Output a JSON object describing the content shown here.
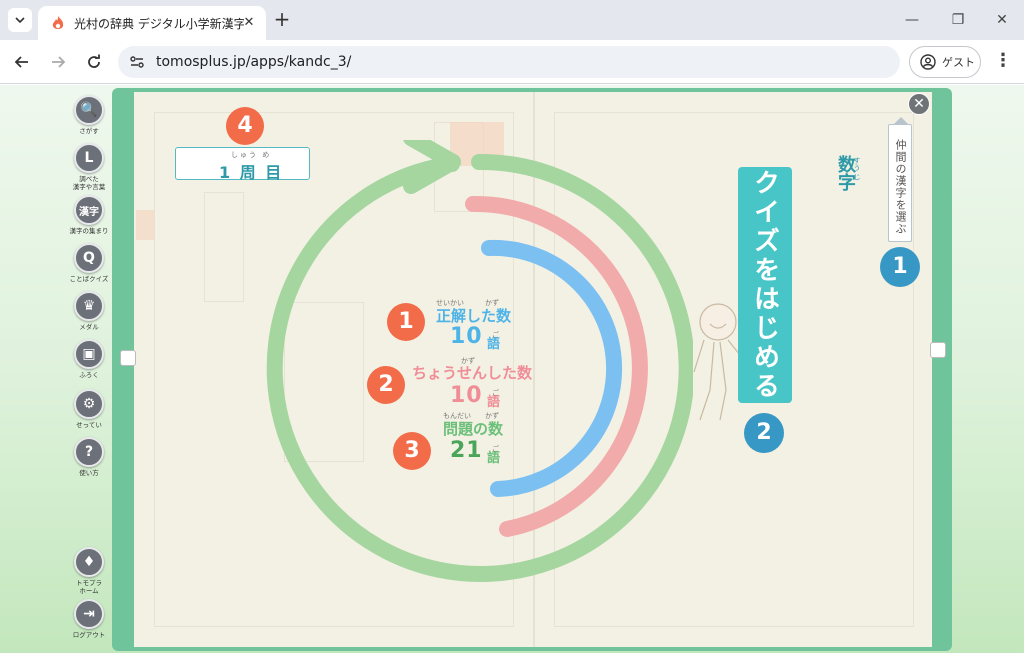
{
  "browser": {
    "tab_title": "光村の辞典 デジタル小学新漢字辞典",
    "url": "tomosplus.jp/apps/kandc_3/",
    "profile_label": "ゲスト"
  },
  "sidebar": {
    "items": [
      {
        "label": "さがす",
        "icon": "search-icon",
        "glyph": "🔍"
      },
      {
        "label": "調べた\n漢字や言葉",
        "icon": "history-icon",
        "glyph": "L"
      },
      {
        "label": "漢字の集まり",
        "icon": "kanji-icon",
        "glyph": "漢字"
      },
      {
        "label": "ことばクイズ",
        "icon": "quiz-icon",
        "glyph": "Q"
      },
      {
        "label": "メダル",
        "icon": "medal-icon",
        "glyph": "♛"
      },
      {
        "label": "ふろく",
        "icon": "gift-icon",
        "glyph": "▣"
      },
      {
        "label": "せってい",
        "icon": "settings-icon",
        "glyph": "⚙"
      },
      {
        "label": "使い方",
        "icon": "help-icon",
        "glyph": "?"
      },
      {
        "label": "トモプラ\nホーム",
        "icon": "home-icon",
        "glyph": "♦"
      },
      {
        "label": "ログアウト",
        "icon": "logout-icon",
        "glyph": "⇥"
      }
    ]
  },
  "quiz": {
    "round_ruby": "しゅう め",
    "round_label": "1 周 目",
    "round_badge": "4",
    "start_label": "クイズをはじめる",
    "start_badge": "2",
    "category_label": "数字",
    "category_ruby": "すう じ",
    "group_select_label": "仲間の漢字を選ぶ",
    "group_badge": "1",
    "close_icon": "close-icon",
    "stats": [
      {
        "badge": "1",
        "ruby": "せいかい　　　かず",
        "label": "正解した数",
        "value": "10",
        "unit_ruby": "ご",
        "unit": "語",
        "color": "#4eb4e8"
      },
      {
        "badge": "2",
        "ruby": "　　　　　　　かず",
        "label": "ちょうせんした数",
        "value": "10",
        "unit_ruby": "ご",
        "unit": "語",
        "color": "#f08e98"
      },
      {
        "badge": "3",
        "ruby": "もんだい　　かず",
        "label": "問題の数",
        "value": "21",
        "unit_ruby": "ご",
        "unit": "語",
        "color": "#6cc07a"
      }
    ]
  },
  "colors": {
    "ring_total": "#a6d6a0",
    "ring_attempted": "#f2abab",
    "ring_correct": "#7cc0f2"
  }
}
